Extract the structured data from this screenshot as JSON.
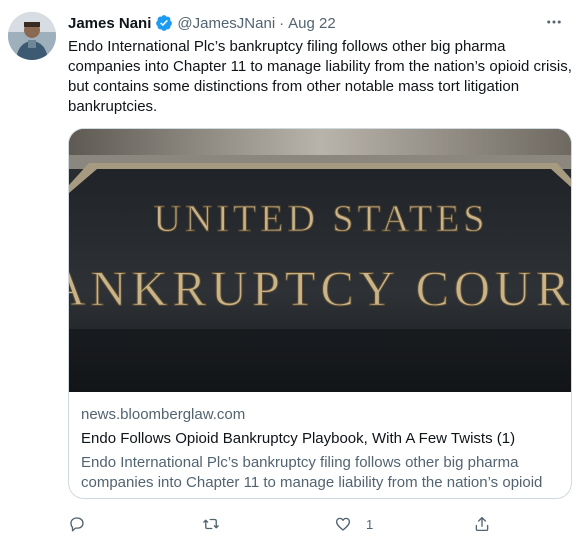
{
  "tweet": {
    "author_name": "James Nani",
    "handle": "@JamesJNani",
    "separator": "·",
    "date": "Aug 22",
    "text": "Endo International Plc’s bankruptcy filing follows other big pharma companies into Chapter 11 to manage liability from the nation’s opioid crisis, but contains some distinctions from other notable mass tort litigation bankruptcies."
  },
  "card": {
    "image_text_line1": "UNITED STATES",
    "image_text_line2": "BANKRUPTCY COURT",
    "domain": "news.bloomberglaw.com",
    "title": "Endo Follows Opioid Bankruptcy Playbook, With A Few Twists (1)",
    "description": "Endo International Plc’s bankruptcy filing follows other big pharma companies into Chapter 11 to manage liability from the nation’s opioid ..."
  },
  "actions": {
    "like_count": "1"
  },
  "colors": {
    "verified": "#1d9bf0",
    "secondary_text": "#536471",
    "border": "#cfd9de"
  },
  "icons": [
    "verified-badge-icon",
    "more-icon",
    "reply-icon",
    "retweet-icon",
    "like-icon",
    "share-icon"
  ]
}
